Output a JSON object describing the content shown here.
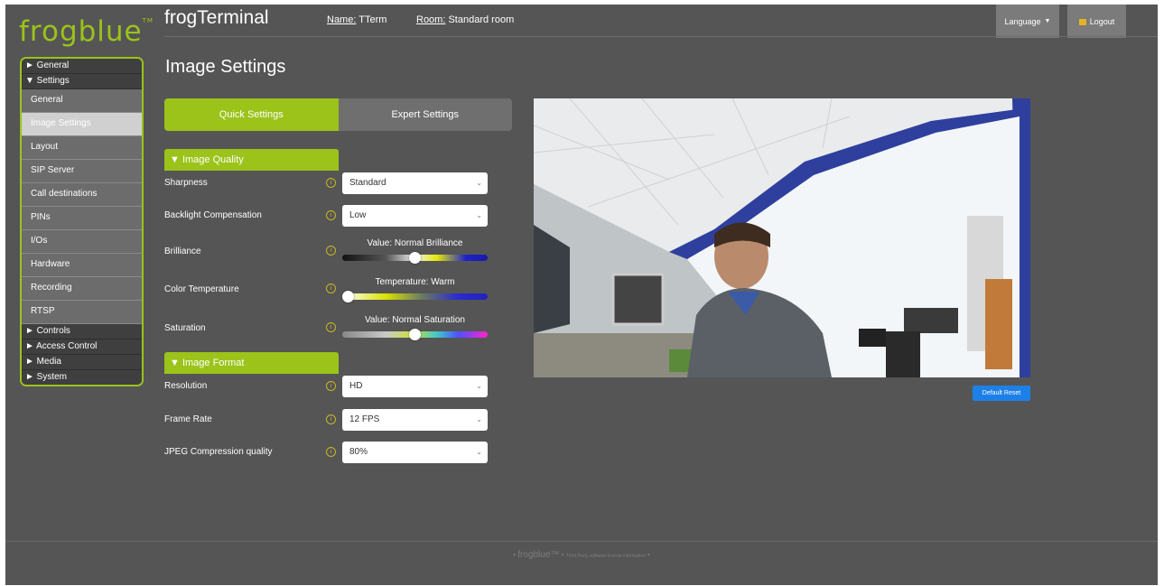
{
  "brand": {
    "logo": "frogblue",
    "tm": "TM",
    "color": "#9bc31a"
  },
  "header": {
    "app_title": "frogTerminal",
    "name_label": "Name:",
    "name_value": "TTerm",
    "room_label": "Room:",
    "room_value": "Standard room",
    "language_label": "Language",
    "logout_label": "Logout"
  },
  "sidebar": {
    "groups": {
      "general": "► General",
      "settings": "▼ Settings",
      "controls": "► Controls",
      "access_control": "► Access Control",
      "media": "► Media",
      "system": "► System"
    },
    "items": [
      {
        "label": "General"
      },
      {
        "label": "Image Settings",
        "active": true
      },
      {
        "label": "Layout"
      },
      {
        "label": "SIP Server"
      },
      {
        "label": "Call destinations"
      },
      {
        "label": "PINs"
      },
      {
        "label": "I/Os"
      },
      {
        "label": "Hardware"
      },
      {
        "label": "Recording"
      },
      {
        "label": "RTSP"
      }
    ]
  },
  "page": {
    "title": "Image Settings"
  },
  "tabs": {
    "quick": "Quick Settings",
    "expert": "Expert Settings"
  },
  "image_quality": {
    "heading": "▼  Image Quality",
    "sharpness": {
      "label": "Sharpness",
      "value": "Standard"
    },
    "backlight": {
      "label": "Backlight Compensation",
      "value": "Low"
    },
    "brilliance": {
      "label": "Brilliance",
      "caption": "Value: Normal Brilliance",
      "level": 0.5
    },
    "color_temp": {
      "label": "Color Temperature",
      "caption": "Temperature: Warm",
      "level": 0.0
    },
    "saturation": {
      "label": "Saturation",
      "caption": "Value: Normal Saturation",
      "level": 0.5
    }
  },
  "image_format": {
    "heading": "▼  Image Format",
    "resolution": {
      "label": "Resolution",
      "value": "HD"
    },
    "frame_rate": {
      "label": "Frame Rate",
      "value": "12 FPS"
    },
    "jpeg": {
      "label": "JPEG Compression quality",
      "value": "80%"
    }
  },
  "camera": {
    "reset_label": "Default Reset"
  },
  "footer": {
    "brand": "frogblue™",
    "license": "Third-Party software license information"
  },
  "icons": {
    "info": "info-circle-icon",
    "chevron": "chevron-down-icon",
    "lock": "lock-icon"
  }
}
